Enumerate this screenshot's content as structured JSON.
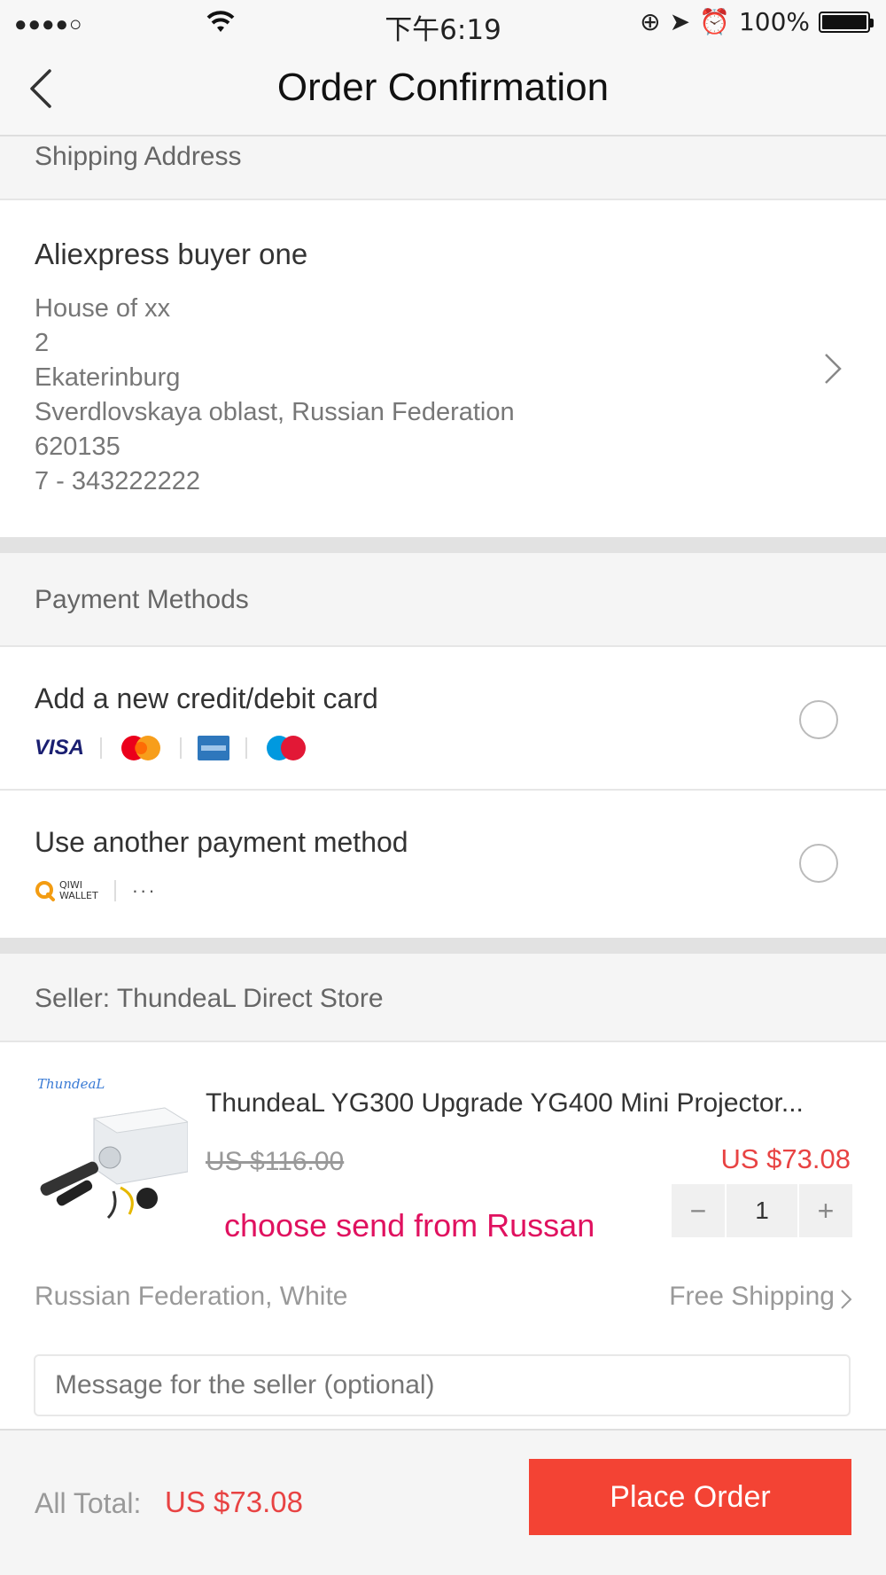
{
  "status_bar": {
    "signal": "●●●●○",
    "time": "下午6:19",
    "battery": "100%",
    "icons": [
      "wifi-icon",
      "rotation-lock-icon",
      "location-icon",
      "alarm-icon",
      "battery-icon"
    ]
  },
  "nav": {
    "title": "Order Confirmation",
    "back_icon": "back-arrow-icon"
  },
  "shipping": {
    "header": "Shipping Address",
    "name": "Aliexpress buyer one",
    "lines": [
      "House of xx",
      "2",
      "Ekaterinburg",
      "Sverdlovskaya oblast, Russian Federation",
      "620135",
      "7 - 343222222"
    ]
  },
  "payment": {
    "header": "Payment Methods",
    "option1": {
      "label": "Add a new credit/debit card",
      "logos": [
        "VISA",
        "MasterCard",
        "American Express",
        "Maestro"
      ]
    },
    "option2": {
      "label": "Use another payment method",
      "logos": [
        "QIWI",
        "WALLET"
      ],
      "more": "···"
    }
  },
  "seller": {
    "header": "Seller: ThundeaL Direct Store",
    "product": {
      "logo_text": "ThundeaL",
      "title": "ThundeaL YG300 Upgrade YG400 Mini Projector...",
      "original_price": "US $116.00",
      "price": "US $73.08",
      "quantity": "1",
      "minus": "−",
      "plus": "+",
      "annotation": "choose send  from Russan",
      "variant": "Russian Federation, White",
      "shipping": "Free Shipping"
    },
    "message_placeholder": "Message for the seller (optional)"
  },
  "footer": {
    "total_label": "All Total:",
    "total_value": "US $73.08",
    "place_order": "Place Order"
  },
  "colors": {
    "accent_red": "#f34334",
    "price_red": "#e84343",
    "annotation_red": "#e0115f"
  }
}
